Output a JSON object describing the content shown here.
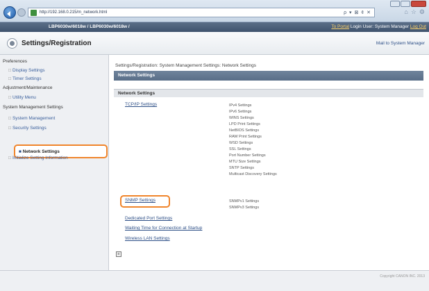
{
  "browser": {
    "url": "http://192.168.0.215/m_network.html",
    "search_glyphs": "ρ ▾ ⊠ ¢ ✕"
  },
  "header_band": {
    "model": "LBP6030w/6018w / LBP6030w/6018w /",
    "portal_link": "To Portal",
    "login_user": "Login User: System Manager",
    "logout": "Log Out"
  },
  "page": {
    "title": "Settings/Registration",
    "mail_link": "Mail to System Manager"
  },
  "sidebar": {
    "preferences": "Preferences",
    "display_settings": "Display Settings",
    "timer_settings": "Timer Settings",
    "adjustment_maintenance": "Adjustment/Maintenance",
    "utility_menu": "Utility Menu",
    "system_management_settings": "System Management Settings",
    "system_management": "System Management",
    "security_settings": "Security Settings",
    "network_settings": "Network Settings",
    "initialize_setting_information": "Initialize Setting Information"
  },
  "main": {
    "breadcrumb": "Settings/Registration: System Management Settings: Network Settings",
    "section_title": "Network Settings",
    "subsection_title": "Network Settings",
    "tcpip": "TCP/IP Settings",
    "tcpip_items": [
      "IPv4 Settings",
      "IPv6 Settings",
      "WINS Settings",
      "LPD Print Settings",
      "NetBIOS Settings",
      "RAW Print Settings",
      "WSD Settings",
      "SSL Settings",
      "Port Number Settings",
      "MTU Size Settings",
      "SNTP Settings",
      "Multicast Discovery Settings"
    ],
    "snmp": "SNMP Settings",
    "snmp_items": [
      "SNMPv1 Settings",
      "SNMPv3 Settings"
    ],
    "dedicated_port": "Dedicated Port Settings",
    "waiting_time": "Waiting Time for Connection at Startup",
    "wireless_lan": "Wireless LAN Settings",
    "top_icon": "≡"
  },
  "footer": {
    "copyright": "Copyright CANON INC. 2013"
  }
}
